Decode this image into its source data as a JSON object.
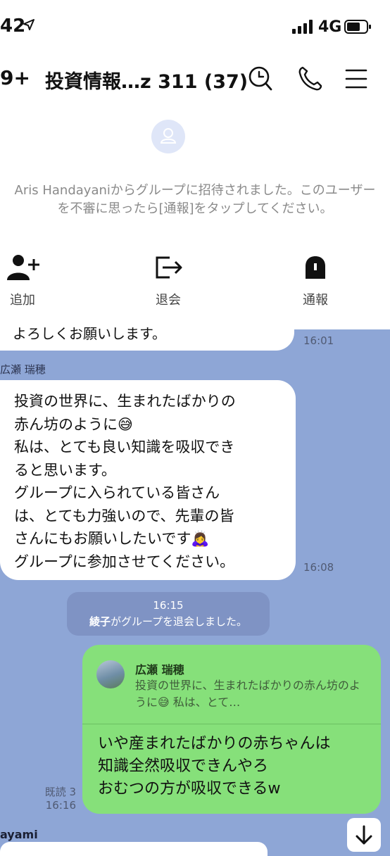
{
  "status_bar": {
    "time": "42",
    "network": "4G"
  },
  "header": {
    "back_count": "9+",
    "title": "投資情報…z 311 (37)"
  },
  "invite": {
    "text": "Aris Handayaniからグループに招待されました。このユーザーを不審に思ったら[通報]をタップしてください。",
    "actions": [
      {
        "label": "追加",
        "icon": "add-user-icon"
      },
      {
        "label": "退会",
        "icon": "leave-icon"
      },
      {
        "label": "通報",
        "icon": "report-icon"
      }
    ]
  },
  "messages": {
    "prev_fragment": "よろしくお願いします。",
    "prev_time": "16:01",
    "sender_1": "広瀬 瑞穂",
    "msg_1_lines": [
      "投資の世界に、生まれたばかりの",
      "赤ん坊のように😅",
      "私は、とても良い知識を吸収でき",
      "ると思います。",
      "グループに入られている皆さん",
      "は、とても力強いので、先輩の皆",
      "さんにもお願いしたいです🙇‍♀️",
      "グループに参加させてください。"
    ],
    "msg_1_time": "16:08",
    "system_time": "16:15",
    "system_name": "綾子",
    "system_text": "がグループを退会しました。",
    "reply_name": "広瀬 瑞穂",
    "reply_quote": "投資の世界に、生まれたばかりの赤ん坊のように😅 私は、とて…",
    "my_msg_lines": [
      "いや産まれたばかりの赤ちゃんは",
      "知識全然吸収できんやろ",
      "おむつの方が吸収できるw"
    ],
    "read_label": "既読 3",
    "my_msg_time": "16:16",
    "bottom_sender": "ayami"
  },
  "colors": {
    "chat_bg": "#8ea6d6",
    "my_bubble": "#86e07a",
    "system_bg": "#7f93c4"
  }
}
